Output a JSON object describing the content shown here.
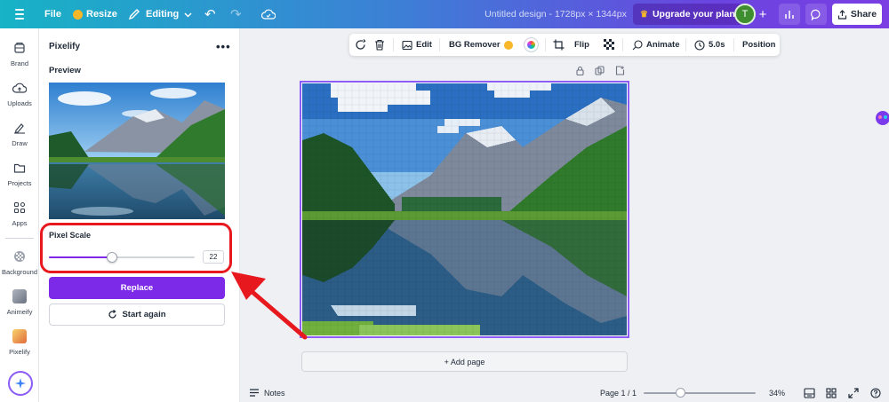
{
  "topbar": {
    "file_label": "File",
    "resize_label": "Resize",
    "editing_label": "Editing",
    "doc_title": "Untitled design - 1728px × 1344px",
    "upgrade_label": "Upgrade your plan",
    "avatar_initial": "T",
    "share_label": "Share"
  },
  "rail": {
    "items": [
      {
        "label": "Brand",
        "icon": "brand-icon"
      },
      {
        "label": "Uploads",
        "icon": "upload-cloud-icon"
      },
      {
        "label": "Draw",
        "icon": "pen-icon"
      },
      {
        "label": "Projects",
        "icon": "folder-icon"
      },
      {
        "label": "Apps",
        "icon": "apps-grid-icon"
      },
      {
        "label": "Background",
        "icon": "checker-icon"
      },
      {
        "label": "Animeify",
        "icon": "animeify-app-icon"
      },
      {
        "label": "Pixelify",
        "icon": "pixelify-app-icon"
      }
    ]
  },
  "panel": {
    "title": "Pixelify",
    "preview_label": "Preview",
    "pixel_scale_label": "Pixel Scale",
    "pixel_scale_value": "22",
    "pixel_scale_fraction": 0.43,
    "replace_label": "Replace",
    "start_again_label": "Start again"
  },
  "context_toolbar": {
    "edit_label": "Edit",
    "bg_remover_label": "BG Remover",
    "flip_label": "Flip",
    "animate_label": "Animate",
    "duration_label": "5.0s",
    "position_label": "Position"
  },
  "canvas": {
    "add_page_label": "+ Add page"
  },
  "footer": {
    "notes_label": "Notes",
    "page_indicator": "Page 1 / 1",
    "zoom_value": "34%",
    "zoom_fraction": 0.33
  },
  "colors": {
    "accent": "#7d2ae8",
    "annotation": "#e8191e",
    "selection": "#8b5cf6"
  }
}
